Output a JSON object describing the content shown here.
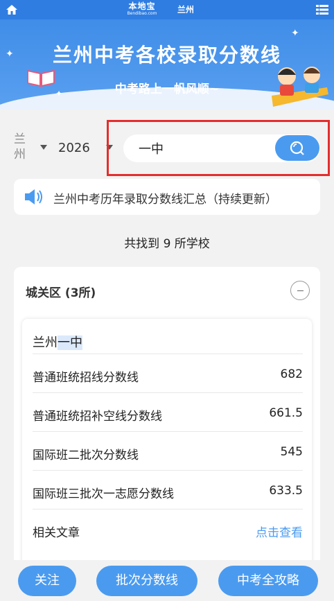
{
  "topbar": {
    "logo_main": "本地宝",
    "logo_sub": "Bendibao.com",
    "city": "兰州",
    "icons": [
      "home-icon",
      "menu-icon"
    ]
  },
  "banner": {
    "title": "兰州中考各校录取分数线",
    "subtitle": "中考路上一帆风顺~"
  },
  "filters": {
    "province": "兰州",
    "year": "2026"
  },
  "search": {
    "value": "一中",
    "icon": "search-icon"
  },
  "notice": {
    "icon": "speaker-icon",
    "text": "兰州中考历年录取分数线汇总（持续更新）"
  },
  "result_count": "共找到 9 所学校",
  "district": {
    "title": "城关区 (3所)"
  },
  "school": {
    "name_prefix": "兰州",
    "name_highlight": "一中",
    "rows": [
      {
        "label": "普通班统招线分数线",
        "value": "682"
      },
      {
        "label": "普通班统招补空线分数线",
        "value": "661.5"
      },
      {
        "label": "国际班二批次分数线",
        "value": "545"
      },
      {
        "label": "国际班三批次一志愿分数线",
        "value": "633.5"
      },
      {
        "label": "相关文章",
        "value": "点击查看"
      }
    ]
  },
  "bottom": {
    "btn1": "关注",
    "btn2": "批次分数线",
    "btn3": "中考全攻略"
  },
  "colors": {
    "primary": "#4a9bf0",
    "topbar": "#2f7de1",
    "highlight_border": "#e52d2d"
  }
}
